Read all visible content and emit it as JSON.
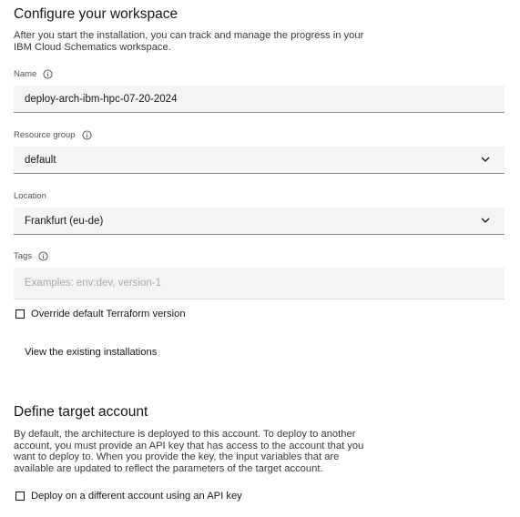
{
  "workspace": {
    "title": "Configure your workspace",
    "description_line1": "After you start the installation, you can track and manage the progress in your",
    "description_line2": "IBM Cloud Schematics workspace.",
    "name": {
      "label": "Name",
      "value": "deploy-arch-ibm-hpc-07-20-2024"
    },
    "resource_group": {
      "label": "Resource group",
      "value": "default"
    },
    "location": {
      "label": "Location",
      "value": "Frankfurt (eu-de)"
    },
    "tags": {
      "label": "Tags",
      "placeholder": "Examples: env:dev, version-1"
    },
    "override_checkbox": {
      "label": "Override default Terraform version",
      "checked": false
    },
    "existing_link": "View the existing installations"
  },
  "target": {
    "title": "Define target account",
    "description_lines": [
      "By default, the architecture is deployed to this account. To deploy to another",
      "account, you must provide an API key that has access to the account that you",
      "want to deploy to. When you provide the key, the input variables that are",
      "available are updated to reflect the parameters of the target account."
    ],
    "api_key_checkbox": {
      "label": "Deploy on a different account using an API key",
      "checked": false
    }
  }
}
